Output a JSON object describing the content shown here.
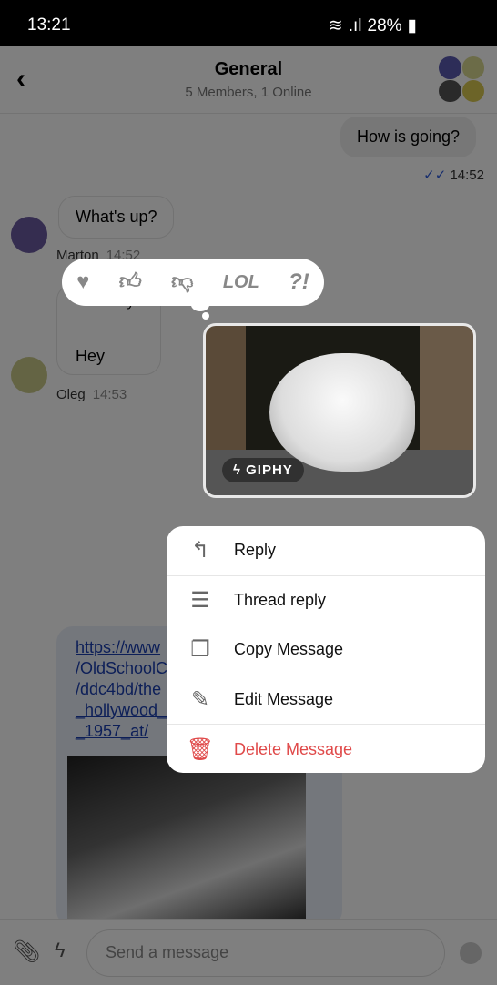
{
  "status_bar": {
    "time": "13:21",
    "battery": "28%"
  },
  "header": {
    "title": "General",
    "subtitle": "5 Members, 1 Online"
  },
  "messages": [
    {
      "text": "How is going?",
      "time": "14:52",
      "read": true
    },
    {
      "text": "What's up?",
      "author": "Marton",
      "time": "14:52"
    },
    {
      "quoted": "Hey",
      "text": "Hey",
      "author": "Oleg",
      "time": "14:53"
    },
    {
      "link": "https://www./OldSchoolC/ddc4bd/the_hollywood__1957_at/"
    }
  ],
  "link_lines": [
    "https://www",
    "/OldSchoolC",
    "/ddc4bd/the",
    "_hollywood_",
    "_1957_at/"
  ],
  "reactions": [
    "heart",
    "thumbs-up",
    "thumbs-down",
    "LOL",
    "?!"
  ],
  "reaction_labels": {
    "lol": "LOL",
    "wut": "?!"
  },
  "giphy": {
    "badge": "GIPHY"
  },
  "menu": {
    "items": [
      "Reply",
      "Thread reply",
      "Copy Message",
      "Edit Message",
      "Delete Message"
    ]
  },
  "composer": {
    "placeholder": "Send a message"
  },
  "colors": {
    "danger": "#e04a4a",
    "link": "#1a3fb0",
    "read_check": "#2f5cdc"
  }
}
